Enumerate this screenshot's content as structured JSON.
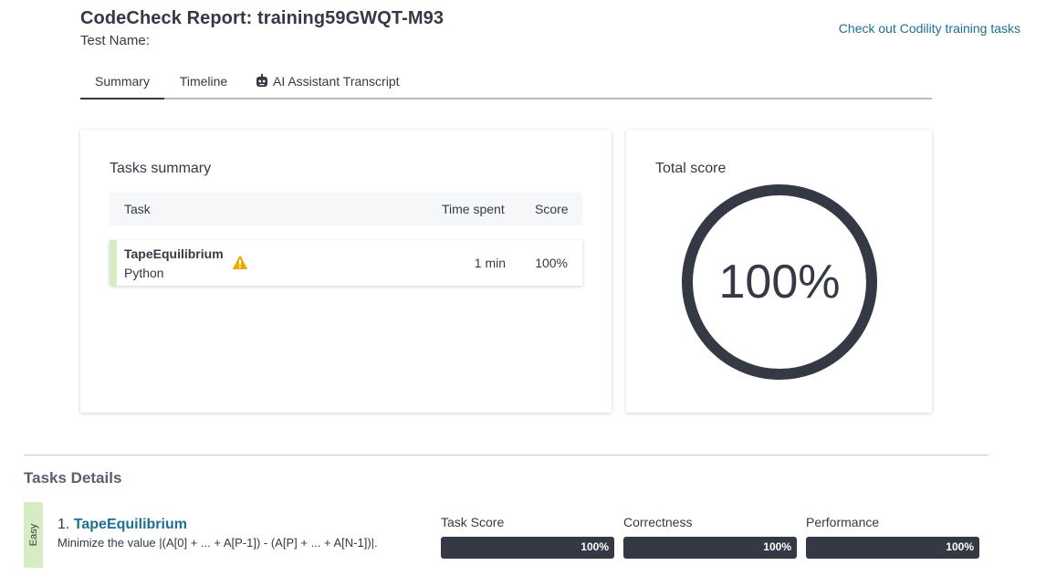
{
  "header": {
    "title": "CodeCheck Report: training59GWQT-M93",
    "test_name_label": "Test Name:",
    "training_link": "Check out Codility training tasks"
  },
  "tabs": [
    {
      "label": "Summary",
      "active": true
    },
    {
      "label": "Timeline",
      "active": false
    },
    {
      "label": "AI Assistant Transcript",
      "icon": "robot-icon",
      "active": false
    }
  ],
  "tasks_summary": {
    "title": "Tasks summary",
    "columns": {
      "task": "Task",
      "time": "Time spent",
      "score": "Score"
    },
    "rows": [
      {
        "name": "TapeEquilibrium",
        "language": "Python",
        "warning_icon": "warning-icon",
        "time": "1 min",
        "score": "100%"
      }
    ]
  },
  "total_score": {
    "title": "Total score",
    "value": "100%",
    "fraction": 1.0,
    "ring_color": "#353945"
  },
  "details": {
    "heading": "Tasks Details",
    "tasks": [
      {
        "difficulty": "Easy",
        "number": "1.",
        "name": "TapeEquilibrium",
        "description": "Minimize the value |(A[0] + ... + A[P-1]) - (A[P] + ... + A[N-1])|.",
        "metrics": [
          {
            "label": "Task Score",
            "value_text": "100%",
            "fraction": 1.0
          },
          {
            "label": "Correctness",
            "value_text": "100%",
            "fraction": 1.0
          },
          {
            "label": "Performance",
            "value_text": "100%",
            "fraction": 1.0
          }
        ]
      }
    ]
  },
  "colors": {
    "accent_link": "#1f6f92",
    "dark": "#353945",
    "easy_green": "#d8ecc3",
    "warning": "#f0a800"
  }
}
